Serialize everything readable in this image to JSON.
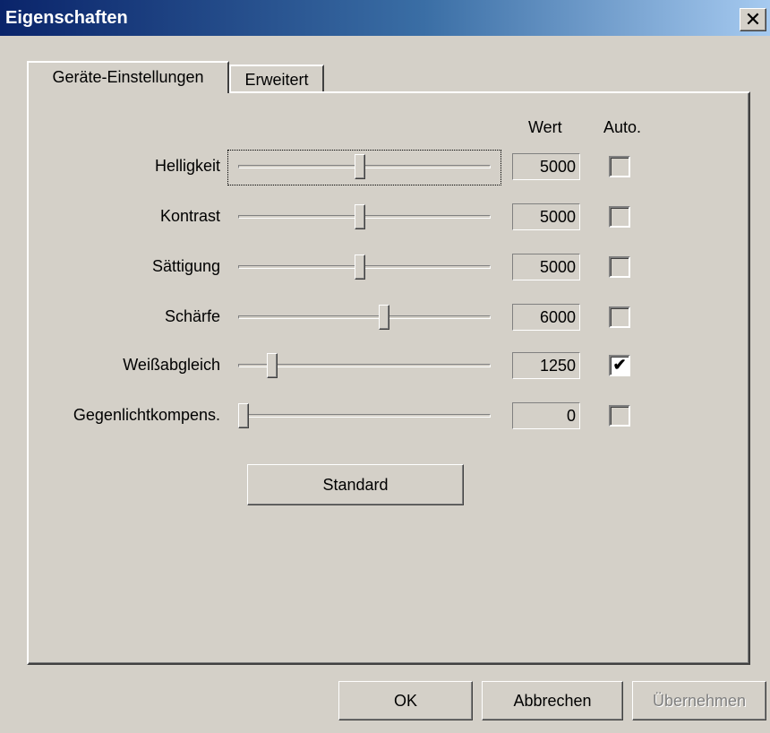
{
  "window": {
    "title": "Eigenschaften",
    "close_glyph": "✕"
  },
  "tabs": [
    {
      "label": "Geräte-Einstellungen",
      "active": true
    },
    {
      "label": "Erweitert",
      "active": false
    }
  ],
  "columns": {
    "value_header": "Wert",
    "auto_header": "Auto."
  },
  "sliders": [
    {
      "label": "Helligkeit",
      "value": "5000",
      "position": 0.48,
      "auto": false,
      "focused": true
    },
    {
      "label": "Kontrast",
      "value": "5000",
      "position": 0.48,
      "auto": false,
      "focused": false
    },
    {
      "label": "Sättigung",
      "value": "5000",
      "position": 0.48,
      "auto": false,
      "focused": false
    },
    {
      "label": "Schärfe",
      "value": "6000",
      "position": 0.58,
      "auto": false,
      "focused": false
    },
    {
      "label": "Weißabgleich",
      "value": "1250",
      "position": 0.12,
      "auto": true,
      "focused": false
    },
    {
      "label": "Gegenlichtkompens.",
      "value": "0",
      "position": 0.0,
      "auto": false,
      "focused": false
    }
  ],
  "buttons": {
    "standard": "Standard",
    "ok": "OK",
    "cancel": "Abbrechen",
    "apply": "Übernehmen"
  },
  "checkmark_glyph": "✔"
}
